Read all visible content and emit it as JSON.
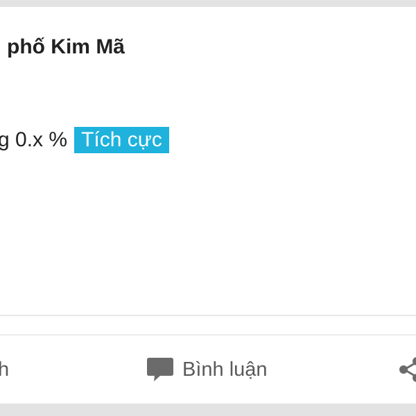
{
  "post": {
    "title": "phố Kim Mã",
    "content_text": "g 0.x %",
    "tag_label": "Tích cực"
  },
  "actions": {
    "left_label": "h",
    "comment_label": "Bình luận"
  },
  "colors": {
    "tag_background": "#1eb2dd",
    "icon_color": "#6b6b6b"
  }
}
